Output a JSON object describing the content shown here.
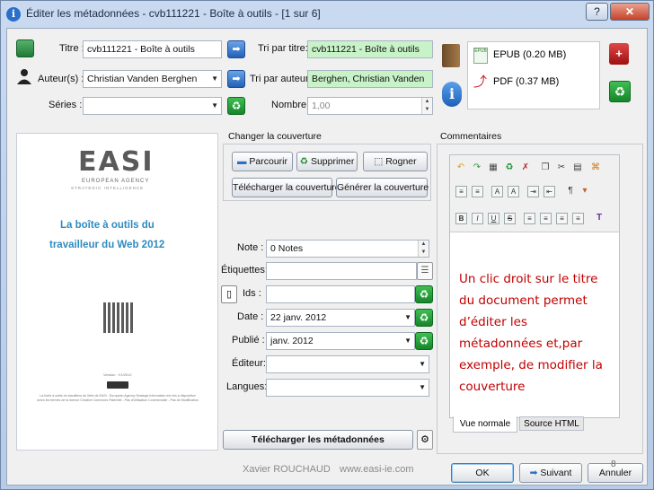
{
  "window": {
    "title": "Éditer les métadonnées - cvb111221 - Boîte à outils - [1 sur 6]",
    "help_label": "?",
    "close_label": "✕"
  },
  "form": {
    "title_label": "Titre :",
    "title_value": "cvb111221 - Boîte à outils",
    "author_label": "Auteur(s) :",
    "author_value": "Christian Vanden Berghen",
    "series_label": "Séries :",
    "series_value": "",
    "sort_title_label": "Tri par titre:",
    "sort_title_value": "cvb111221 - Boîte à outils",
    "sort_author_label": "Tri par auteur:",
    "sort_author_value": "Berghen, Christian Vanden",
    "number_label": "Nombre:",
    "number_value": "1,00"
  },
  "formats": [
    {
      "label": "EPUB (0.20 MB)",
      "badge": "EPUB"
    },
    {
      "label": "PDF (0.37 MB)",
      "badge": "PDF"
    }
  ],
  "cover": {
    "group_title": "Changer la couverture",
    "browse_label": "Parcourir",
    "delete_label": "Supprimer",
    "trim_label": "Rogner",
    "download_label": "Télécharger la couverture",
    "generate_label": "Générer la couverture",
    "logo_text": "EASI",
    "logo_sub1": "EUROPEAN AGENCY",
    "logo_sub2": "STRATEGIC INTELLIGENCE",
    "book_title_line1": "La boîte à outils du",
    "book_title_line2": "travailleur du Web 2012",
    "version_text": "Version : V1/2012",
    "license_text": "La boîte à outils du travailleur du Web de EASI - European Agency Strategic Information est mis à disposition selon les termes de la licence Creative Commons Paternité - Pas d'Utilisation Commerciale - Pas de Modification"
  },
  "details": {
    "rating_label": "Note :",
    "rating_value": "0 Notes",
    "tags_label": "Étiquettes:",
    "tags_value": "",
    "ids_label": "Ids :",
    "ids_value": "",
    "date_label": "Date :",
    "date_value": "22 janv. 2012",
    "published_label": "Publié :",
    "published_value": "janv. 2012",
    "publisher_label": "Éditeur:",
    "publisher_value": "",
    "languages_label": "Langues:",
    "languages_value": "",
    "download_metadata_label": "Télécharger les métadonnées"
  },
  "comments": {
    "title": "Commentaires",
    "annotation": "Un clic droit sur le titre du document permet d’éditer les métadonnées et,par exemple, de modifier la couverture",
    "tab_normal": "Vue normale",
    "tab_html": "Source HTML"
  },
  "footer": {
    "author": "Xavier ROUCHAUD",
    "website": "www.easi-ie.com",
    "ok_label": "OK",
    "next_label": "Suivant",
    "cancel_label": "Annuler",
    "slide_number": "8"
  },
  "colors": {
    "sort_field_bg": "#c8f2c8",
    "annotation_text": "#c00000",
    "cover_title": "#2e8bc0"
  }
}
